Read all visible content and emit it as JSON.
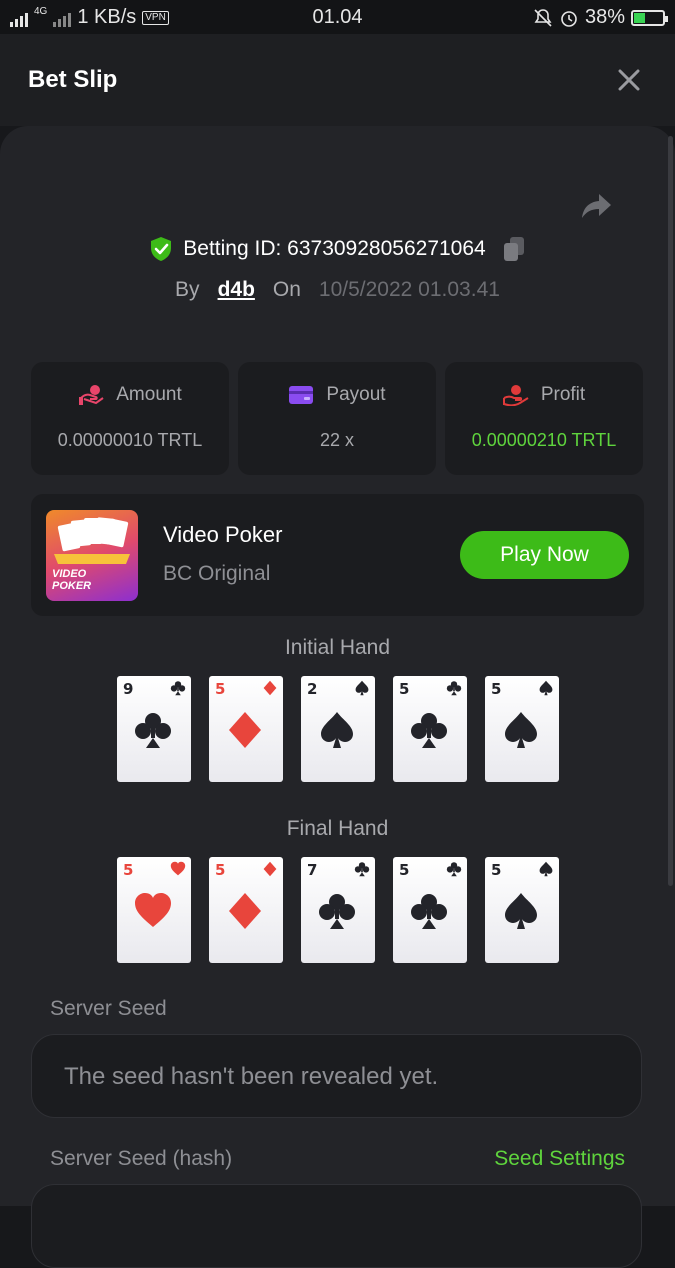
{
  "status": {
    "net_type": "4G",
    "speed": "1 KB/s",
    "vpn": "VPN",
    "time": "01.04",
    "battery": "38%"
  },
  "header": {
    "title": "Bet Slip"
  },
  "bet": {
    "id_label": "Betting ID: 63730928056271064",
    "by_label": "By",
    "user": "d4b",
    "on_label": "On",
    "date": "10/5/2022 01.03.41"
  },
  "stats": {
    "amount_label": "Amount",
    "amount_value": "0.00000010 TRTL",
    "payout_label": "Payout",
    "payout_value": "22 x",
    "profit_label": "Profit",
    "profit_value": "0.00000210 TRTL"
  },
  "game": {
    "name": "Video Poker",
    "sub": "BC Original",
    "play_label": "Play Now",
    "thumb_text": "VIDEO POKER"
  },
  "initial_hand": {
    "title": "Initial Hand",
    "cards": [
      {
        "rank": "9",
        "suit": "club"
      },
      {
        "rank": "5",
        "suit": "diamond"
      },
      {
        "rank": "2",
        "suit": "spade"
      },
      {
        "rank": "5",
        "suit": "club"
      },
      {
        "rank": "5",
        "suit": "spade"
      }
    ]
  },
  "final_hand": {
    "title": "Final Hand",
    "cards": [
      {
        "rank": "5",
        "suit": "heart"
      },
      {
        "rank": "5",
        "suit": "diamond"
      },
      {
        "rank": "7",
        "suit": "club"
      },
      {
        "rank": "5",
        "suit": "club"
      },
      {
        "rank": "5",
        "suit": "spade"
      }
    ]
  },
  "seed": {
    "server_seed_label": "Server Seed",
    "server_seed_placeholder": "The seed hasn't been revealed yet.",
    "server_seed_hash_label": "Server Seed (hash)",
    "seed_settings_label": "Seed Settings"
  },
  "colors": {
    "accent_green": "#3dbb18",
    "text_green": "#5fd43d",
    "red_suit": "#e8453c",
    "black_suit": "#23242a"
  }
}
